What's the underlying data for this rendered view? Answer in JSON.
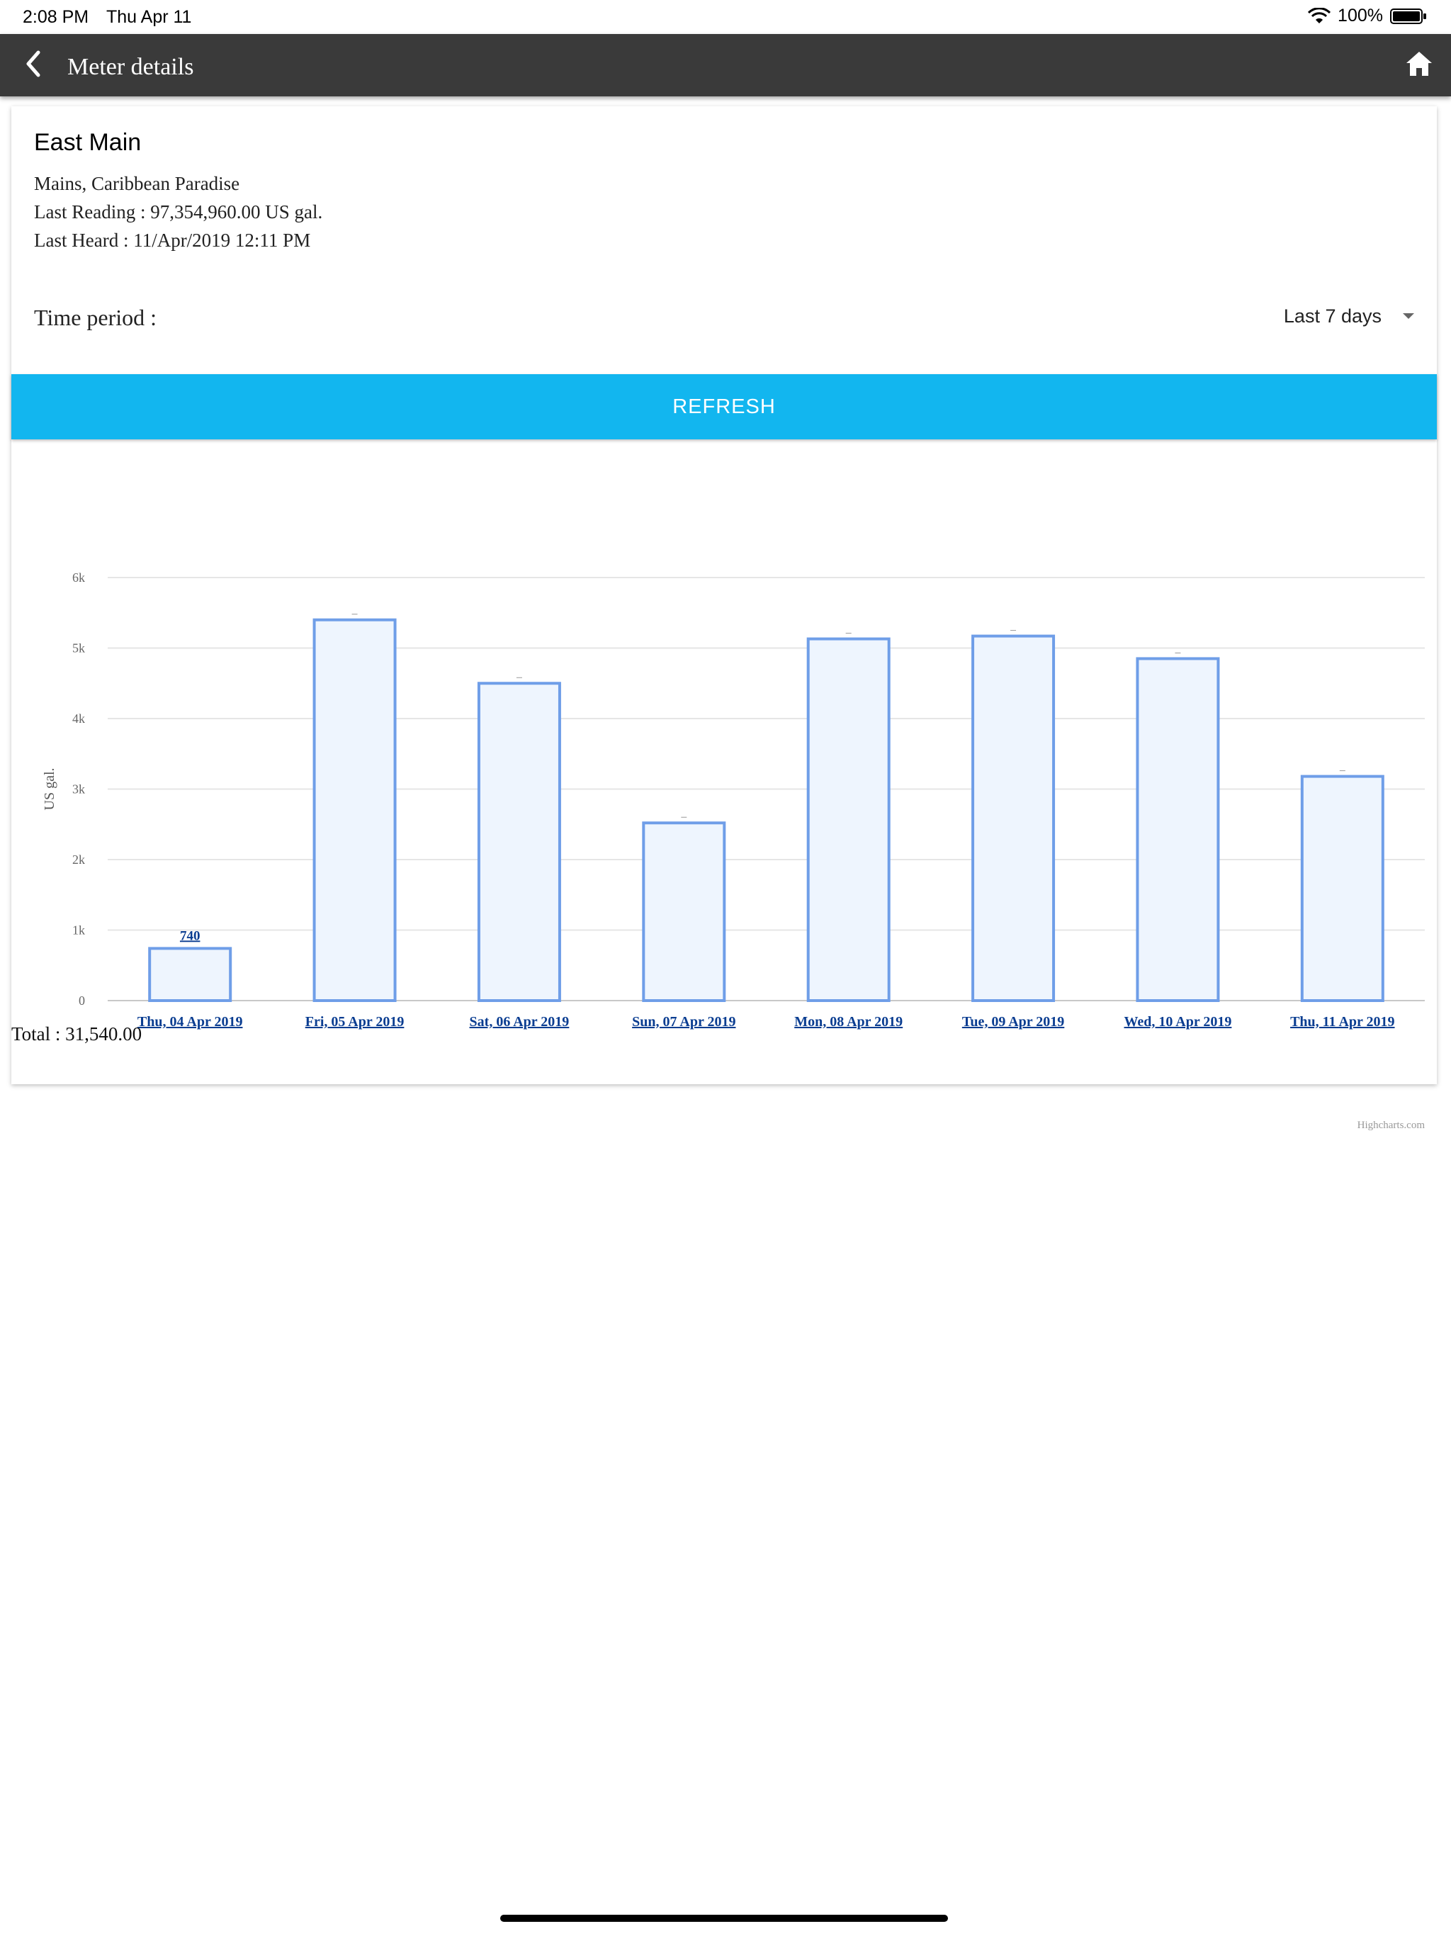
{
  "status_bar": {
    "time": "2:08 PM",
    "date": "Thu Apr 11",
    "battery": "100%"
  },
  "nav": {
    "title": "Meter details",
    "back_icon": "chevron-left-icon",
    "home_icon": "home-icon"
  },
  "meter": {
    "name": "East Main",
    "location": "Mains, Caribbean Paradise",
    "last_reading": "Last Reading : 97,354,960.00 US gal.",
    "last_heard": "Last Heard : 11/Apr/2019 12:11 PM"
  },
  "period": {
    "label": "Time period :",
    "value": "Last 7 days"
  },
  "refresh_label": "REFRESH",
  "total": "Total : 31,540.00",
  "colors": {
    "nav_bg": "#3a3a3a",
    "refresh_bg": "#12b6ef",
    "bar_fill": "#eef5fe",
    "bar_stroke": "#6f9ee8",
    "axis_label": "#0a3d91"
  },
  "chart_data": {
    "type": "bar",
    "categories": [
      "Thu, 04 Apr 2019",
      "Fri, 05 Apr 2019",
      "Sat, 06 Apr 2019",
      "Sun, 07 Apr 2019",
      "Mon, 08 Apr 2019",
      "Tue, 09 Apr 2019",
      "Wed, 10 Apr 2019",
      "Thu, 11 Apr 2019"
    ],
    "values": [
      740,
      5400,
      4500,
      2520,
      5130,
      5170,
      4850,
      3180
    ],
    "data_labels": [
      "740",
      "",
      "",
      "",
      "",
      "",
      "",
      ""
    ],
    "ylabel": "US gal.",
    "yticks": [
      "0",
      "1k",
      "2k",
      "3k",
      "4k",
      "5k",
      "6k"
    ],
    "ylim": [
      0,
      6000
    ],
    "grid": true,
    "credit": "Highcharts.com"
  }
}
